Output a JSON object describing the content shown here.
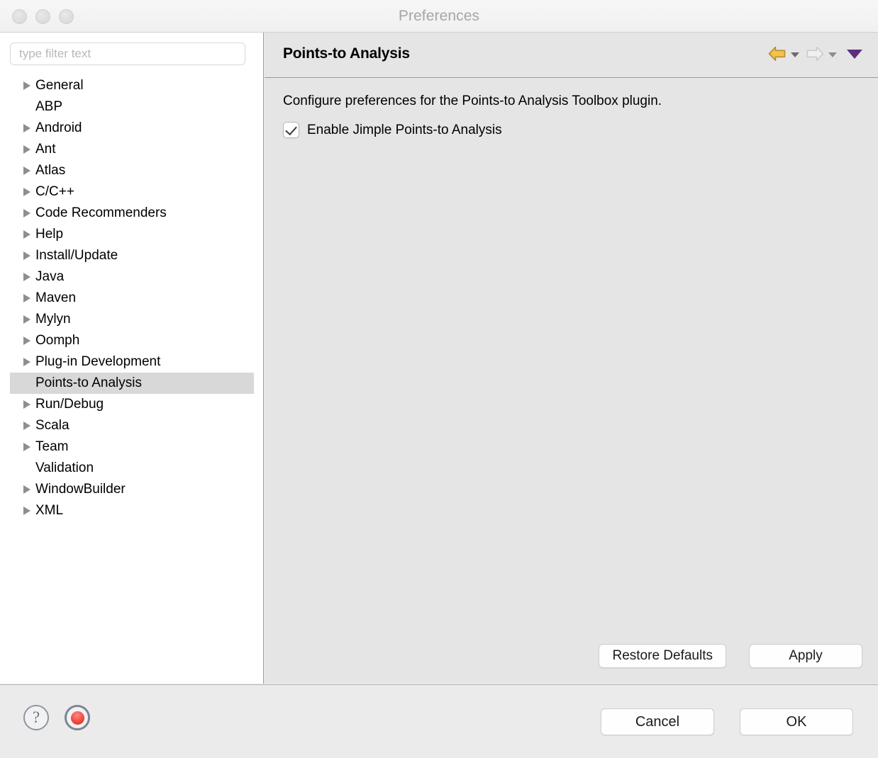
{
  "window": {
    "title": "Preferences",
    "traffic_lights": [
      "close",
      "minimize",
      "zoom"
    ]
  },
  "sidebar": {
    "filter": {
      "placeholder": "type filter text",
      "value": ""
    },
    "items": [
      {
        "label": "General",
        "expandable": true,
        "selected": false
      },
      {
        "label": "ABP",
        "expandable": false,
        "selected": false
      },
      {
        "label": "Android",
        "expandable": true,
        "selected": false
      },
      {
        "label": "Ant",
        "expandable": true,
        "selected": false
      },
      {
        "label": "Atlas",
        "expandable": true,
        "selected": false
      },
      {
        "label": "C/C++",
        "expandable": true,
        "selected": false
      },
      {
        "label": "Code Recommenders",
        "expandable": true,
        "selected": false
      },
      {
        "label": "Help",
        "expandable": true,
        "selected": false
      },
      {
        "label": "Install/Update",
        "expandable": true,
        "selected": false
      },
      {
        "label": "Java",
        "expandable": true,
        "selected": false
      },
      {
        "label": "Maven",
        "expandable": true,
        "selected": false
      },
      {
        "label": "Mylyn",
        "expandable": true,
        "selected": false
      },
      {
        "label": "Oomph",
        "expandable": true,
        "selected": false
      },
      {
        "label": "Plug-in Development",
        "expandable": true,
        "selected": false
      },
      {
        "label": "Points-to Analysis",
        "expandable": false,
        "selected": true
      },
      {
        "label": "Run/Debug",
        "expandable": true,
        "selected": false
      },
      {
        "label": "Scala",
        "expandable": true,
        "selected": false
      },
      {
        "label": "Team",
        "expandable": true,
        "selected": false
      },
      {
        "label": "Validation",
        "expandable": false,
        "selected": false
      },
      {
        "label": "WindowBuilder",
        "expandable": true,
        "selected": false
      },
      {
        "label": "XML",
        "expandable": true,
        "selected": false
      }
    ]
  },
  "page": {
    "title": "Points-to Analysis",
    "description": "Configure preferences for the Points-to Analysis Toolbox plugin.",
    "checkbox": {
      "label": "Enable Jimple Points-to Analysis",
      "checked": true
    },
    "nav": {
      "back_icon": "back-arrow-icon",
      "back_enabled": true,
      "back_color": "#f0c040",
      "forward_icon": "forward-arrow-icon",
      "forward_enabled": false,
      "forward_color": "#e6e6e6",
      "menu_icon": "dropdown-triangle-icon",
      "menu_color": "#5b2f7f"
    },
    "buttons": {
      "restore_defaults": "Restore Defaults",
      "apply": "Apply"
    }
  },
  "footer": {
    "help_icon": "question-mark-icon",
    "record_icon": "record-button-icon",
    "record_color": "#ef4a41",
    "buttons": {
      "cancel": "Cancel",
      "ok": "OK"
    }
  }
}
